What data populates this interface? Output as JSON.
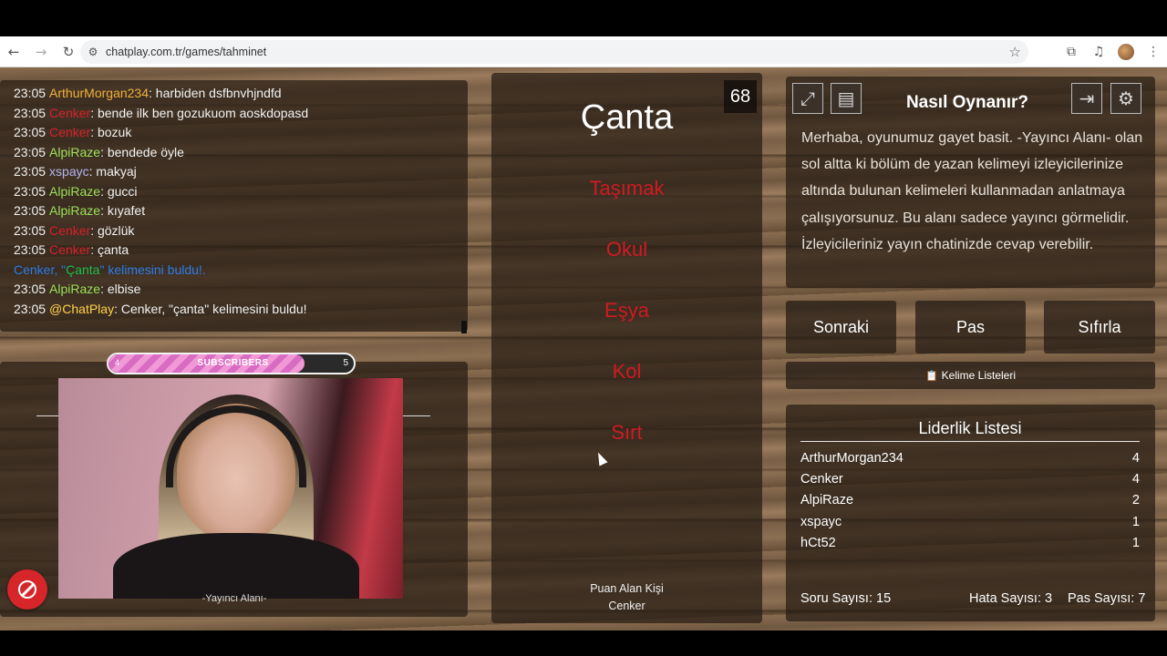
{
  "browser": {
    "url": "chatplay.com.tr/games/tahminet"
  },
  "chat": {
    "messages": [
      {
        "time": "23:05",
        "user": "ArthurMorgan234",
        "user_color": "#f0b03a",
        "text": ": harbiden dsfbnvhjndfd"
      },
      {
        "time": "23:05",
        "user": "Cenker",
        "user_color": "#d8202a",
        "text": ": bende ilk ben gozukuom aoskdopasd"
      },
      {
        "time": "23:05",
        "user": "Cenker",
        "user_color": "#d8202a",
        "text": ": bozuk"
      },
      {
        "time": "23:05",
        "user": "AlpiRaze",
        "user_color": "#9be25a",
        "text": ": bendede öyle"
      },
      {
        "time": "23:05",
        "user": "xspayc",
        "user_color": "#b8b6f0",
        "text": ": makyaj"
      },
      {
        "time": "23:05",
        "user": "AlpiRaze",
        "user_color": "#9be25a",
        "text": ": gucci"
      },
      {
        "time": "23:05",
        "user": "AlpiRaze",
        "user_color": "#9be25a",
        "text": ": kıyafet"
      },
      {
        "time": "23:05",
        "user": "Cenker",
        "user_color": "#d8202a",
        "text": ": gözlük"
      },
      {
        "time": "23:05",
        "user": "Cenker",
        "user_color": "#d8202a",
        "text": ": çanta"
      }
    ],
    "system": {
      "before": "Cenker, \"",
      "word": "Çanta",
      "after": "\" kelimesini buldu!."
    },
    "messages2": [
      {
        "time": "23:05",
        "user": "AlpiRaze",
        "user_color": "#9be25a",
        "text": ": elbise"
      },
      {
        "time": "23:05",
        "user": "@ChatPlay",
        "user_color": "#ffd24a",
        "text": ": Cenker, \"çanta\" kelimesini buldu!"
      }
    ]
  },
  "webcam": {
    "subscribers_label": "SUBSCRIBERS",
    "subscribers_min": "4",
    "subscribers_max": "5",
    "subscribers_progress": 0.8,
    "caption": "-Yayıncı Alanı-"
  },
  "game": {
    "timer": "68",
    "word": "Çanta",
    "forbidden": [
      "Taşımak",
      "Okul",
      "Eşya",
      "Kol",
      "Sırt"
    ],
    "scorer_label": "Puan Alan Kişi",
    "scorer_name": "Cenker"
  },
  "howto": {
    "title": "Nasıl Oynanır?",
    "text": "Merhaba, oyunumuz gayet basit. -Yayıncı Alanı- olan sol altta ki bölüm de yazan kelimeyi izleyicilerinize altında bulunan kelimeleri kullanmadan anlatmaya çalışıyorsunuz. Bu alanı sadece yayıncı görmelidir. İzleyicileriniz yayın chatinizde cevap verebilir."
  },
  "buttons": {
    "next": "Sonraki",
    "pass": "Pas",
    "reset": "Sıfırla",
    "word_lists": "Kelime Listeleri"
  },
  "leaderboard": {
    "title": "Liderlik Listesi",
    "rows": [
      {
        "name": "ArthurMorgan234",
        "score": "4"
      },
      {
        "name": "Cenker",
        "score": "4"
      },
      {
        "name": "AlpiRaze",
        "score": "2"
      },
      {
        "name": "xspayc",
        "score": "1"
      },
      {
        "name": "hCt52",
        "score": "1"
      }
    ]
  },
  "stats": {
    "questions": "Soru Sayısı: 15",
    "errors": "Hata Sayısı: 3",
    "passes": "Pas Sayısı: 7"
  },
  "icons": [
    "back-icon",
    "forward-icon",
    "reload-icon",
    "site-settings-icon",
    "star-icon",
    "extensions-icon",
    "media-icon",
    "menu-icon",
    "fullscreen-icon",
    "notes-icon",
    "exit-icon",
    "settings-icon",
    "block-icon",
    "clipboard-icon"
  ]
}
